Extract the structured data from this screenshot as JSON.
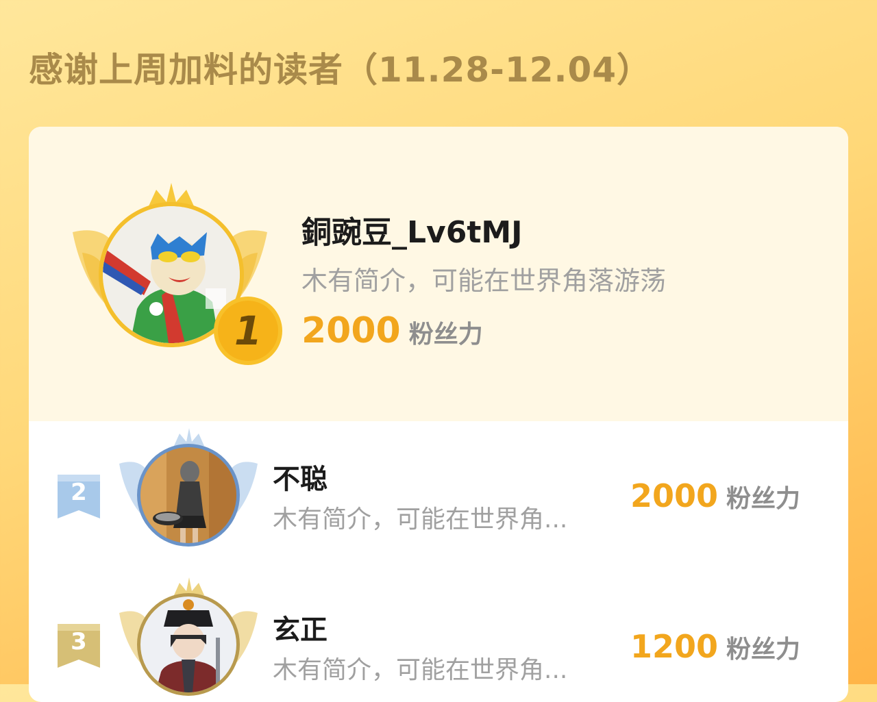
{
  "header": {
    "title": "感谢上周加料的读者（11.28-12.04）"
  },
  "top_reader": {
    "rank": "1",
    "name": "銅豌豆_Lv6tMJ",
    "bio": "木有简介，可能在世界角落游荡",
    "fans_value": "2000",
    "fans_unit": "粉丝力"
  },
  "readers": [
    {
      "rank": "2",
      "name": "不聪",
      "bio": "木有简介，可能在世界角...",
      "fans_value": "2000",
      "fans_unit": "粉丝力"
    },
    {
      "rank": "3",
      "name": "玄正",
      "bio": "木有简介，可能在世界角...",
      "fans_value": "1200",
      "fans_unit": "粉丝力"
    }
  ],
  "colors": {
    "gold": "#f2a61d",
    "silver": "#9fc1e3",
    "bronze": "#d9c27a",
    "title": "#a98a4a"
  }
}
